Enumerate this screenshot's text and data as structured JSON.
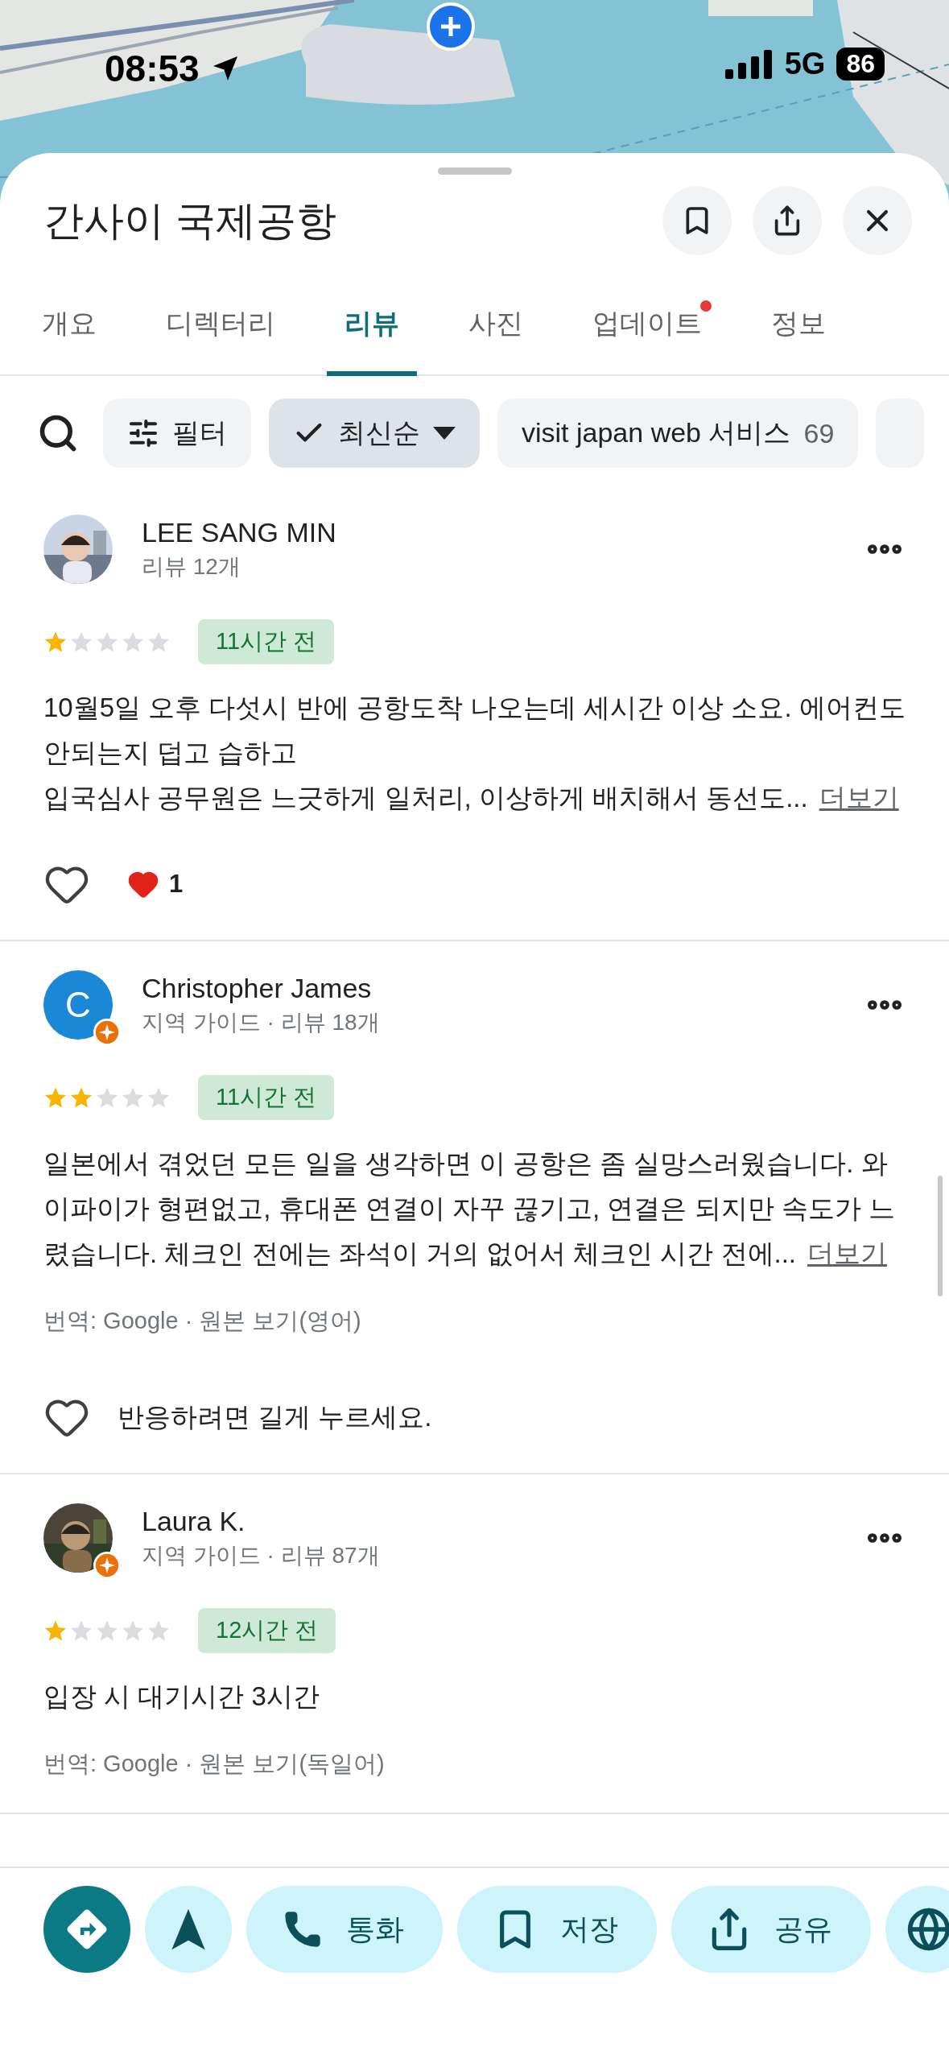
{
  "status_bar": {
    "time": "08:53",
    "network": "5G",
    "battery": "86"
  },
  "place": {
    "title": "간사이 국제공항"
  },
  "header_actions": [
    {
      "kind": "save"
    },
    {
      "kind": "share"
    },
    {
      "kind": "close"
    }
  ],
  "tabs": [
    {
      "label": "개요",
      "selected": false,
      "dot": false
    },
    {
      "label": "디렉터리",
      "selected": false,
      "dot": false
    },
    {
      "label": "리뷰",
      "selected": true,
      "dot": false
    },
    {
      "label": "사진",
      "selected": false,
      "dot": false
    },
    {
      "label": "업데이트",
      "selected": false,
      "dot": true
    },
    {
      "label": "정보",
      "selected": false,
      "dot": false
    }
  ],
  "chips": [
    {
      "kind": "filter",
      "label": "필터",
      "selected": false
    },
    {
      "kind": "sort",
      "label": "최신순",
      "selected": true
    },
    {
      "kind": "topic",
      "label": "visit japan web 서비스",
      "count": "69",
      "selected": false
    },
    {
      "kind": "partial",
      "selected": false
    }
  ],
  "reviews": [
    {
      "author": "LEE SANG MIN",
      "local_guide": false,
      "meta": "리뷰 12개",
      "stars": 1,
      "time": "11시간 전",
      "text": "10월5일 오후 다섯시 반에 공항도착 나오는데 세시간 이상 소요. 에어컨도 안되는지 덥고 습하고\n입국심사 공무원은 느긋하게 일처리, 이상하게 배치해서 동선도...",
      "more": "더보기",
      "footer": {
        "kind": "reactions",
        "count": "1"
      }
    },
    {
      "author": "Christopher James",
      "avatar": {
        "kind": "initial",
        "initial": "C"
      },
      "local_guide": true,
      "meta": "지역 가이드 · 리뷰 18개",
      "stars": 2,
      "time": "11시간 전",
      "text": "일본에서 겪었던 모든 일을 생각하면 이 공항은 좀 실망스러웠습니다. 와이파이가 형편없고, 휴대폰 연결이 자꾸 끊기고, 연결은 되지만 속도가 느렸습니다. 체크인 전에는 좌석이 거의 없어서 체크인 시간 전에...",
      "more": "더보기",
      "translation": "번역: Google · 원본 보기(영어)",
      "footer": {
        "kind": "hint",
        "text": "반응하려면 길게 누르세요."
      }
    },
    {
      "author": "Laura K.",
      "local_guide": true,
      "meta": "지역 가이드 · 리뷰 87개",
      "stars": 1,
      "time": "12시간 전",
      "text": "입장 시 대기시간 3시간",
      "translation": "번역: Google · 원본 보기(독일어)"
    }
  ],
  "actions": [
    {
      "kind": "directions"
    },
    {
      "kind": "start"
    },
    {
      "kind": "call",
      "label": "통화"
    },
    {
      "kind": "save",
      "label": "저장"
    },
    {
      "kind": "share",
      "label": "공유"
    },
    {
      "kind": "website"
    }
  ]
}
